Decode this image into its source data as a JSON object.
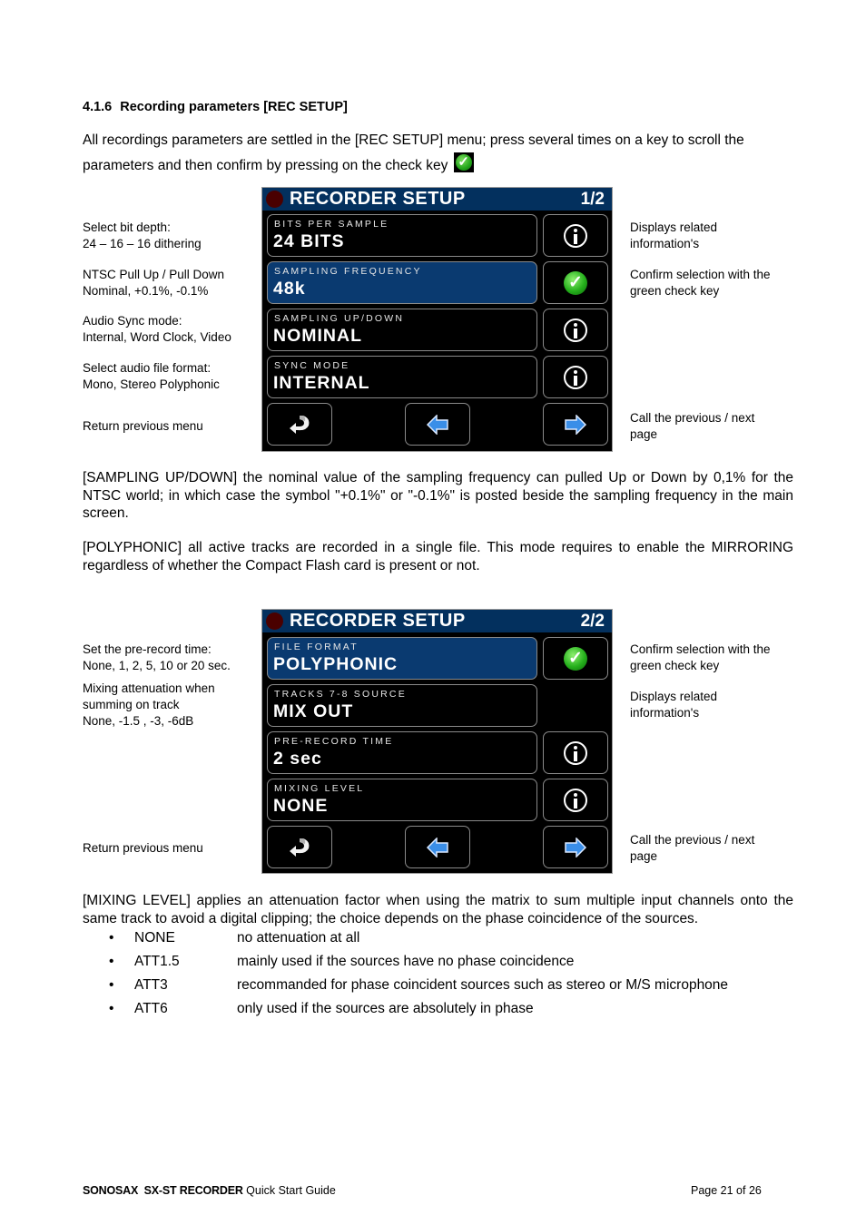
{
  "section": {
    "number": "4.1.6",
    "title": "Recording parameters [REC SETUP]"
  },
  "intro": {
    "text": "All recordings parameters are settled in the [REC SETUP] menu; press several times on a key to scroll the parameters and then confirm by pressing on the check key",
    "icon": "green-check-icon"
  },
  "screen1": {
    "title": "RECORDER SETUP",
    "page": "1/2",
    "params": [
      {
        "label": "BITS PER SAMPLE",
        "value": "24 BITS",
        "selected": false,
        "key": "info"
      },
      {
        "label": "SAMPLING FREQUENCY",
        "value": "48k",
        "selected": true,
        "key": "check"
      },
      {
        "label": "SAMPLING UP/DOWN",
        "value": "NOMINAL",
        "selected": false,
        "key": "info"
      },
      {
        "label": "SYNC MODE",
        "value": "INTERNAL",
        "selected": false,
        "key": "info"
      }
    ],
    "nav": {
      "back": "return-icon",
      "prev": "arrow-left-icon",
      "next": "arrow-right-icon"
    },
    "left_notes": [
      "Select bit depth:\n24 – 16 – 16 dithering",
      "NTSC Pull Up / Pull Down\nNominal, +0.1%, -0.1%",
      "Audio Sync mode:\nInternal, Word Clock, Video",
      "Select audio file format:\nMono, Stereo Polyphonic",
      "Return previous menu"
    ],
    "right_notes": [
      "Displays related\ninformation's",
      "Confirm selection with the\ngreen check key",
      "Call the previous /  next\npage"
    ]
  },
  "para_sampling": "[SAMPLING UP/DOWN] the nominal value of the sampling frequency can pulled Up or Down by 0,1% for the NTSC world; in which case the symbol \"+0.1%\" or \"-0.1%\" is posted beside the sampling frequency in the main screen.",
  "para_polyphonic": "[POLYPHONIC] all active tracks are recorded in a single file. This mode requires to enable the MIRRORING regardless of whether the Compact Flash card is present or not.",
  "screen2": {
    "title": "RECORDER SETUP",
    "page": "2/2",
    "params": [
      {
        "label": "FILE FORMAT",
        "value": "POLYPHONIC",
        "selected": true,
        "key": "check"
      },
      {
        "label": "TRACKS 7-8 SOURCE",
        "value": "MIX OUT",
        "selected": false,
        "key": "none"
      },
      {
        "label": "PRE-RECORD TIME",
        "value": "2 sec",
        "selected": false,
        "key": "info"
      },
      {
        "label": "MIXING LEVEL",
        "value": "NONE",
        "selected": false,
        "key": "info"
      }
    ],
    "nav": {
      "back": "return-icon",
      "prev": "arrow-left-icon",
      "next": "arrow-right-icon"
    },
    "left_notes": [
      "Set the pre-record time:\nNone, 1, 2, 5, 10 or 20 sec.",
      "Mixing attenuation when\nsumming on track\nNone, -1.5 , -3,  -6dB",
      "Return previous menu"
    ],
    "right_notes": [
      "Confirm selection with the\ngreen check key",
      "Displays related\ninformation's",
      "Call the previous /  next\npage"
    ]
  },
  "para_mixing": "[MIXING LEVEL] applies an attenuation factor when using the matrix to sum multiple input channels onto the same track to avoid a digital clipping; the choice depends on the phase coincidence of the sources.",
  "mixing_options": [
    {
      "term": "NONE",
      "desc": "no attenuation at all"
    },
    {
      "term": "ATT1.5",
      "desc": "mainly used if the sources have no phase coincidence"
    },
    {
      "term": "ATT3",
      "desc": "recommanded for phase coincident sources such as stereo or M/S microphone"
    },
    {
      "term": "ATT6",
      "desc": "only used if the sources are absolutely in phase"
    }
  ],
  "footer": {
    "brand": "SONOSAX  SX-ST RECORDER",
    "doc": " Quick Start Guide",
    "page": "Page 21 of 26"
  },
  "colors": {
    "titlebar": "#03305e",
    "selected_param": "#0a3a70",
    "check_green": "#25b01c",
    "arrow_blue": "#3a8ee8",
    "rec_dot": "#4a0000"
  }
}
